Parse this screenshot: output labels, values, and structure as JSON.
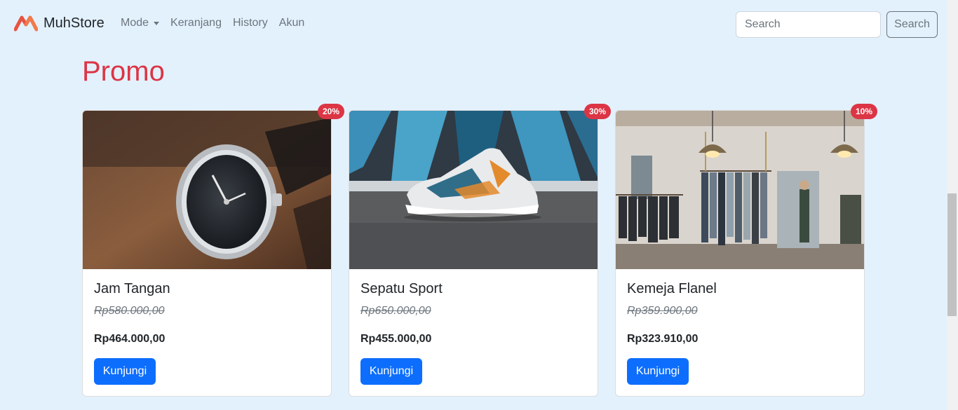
{
  "navbar": {
    "brand": "MuhStore",
    "items": [
      {
        "label": "Mode"
      },
      {
        "label": "Keranjang"
      },
      {
        "label": "History"
      },
      {
        "label": "Akun"
      }
    ],
    "search_placeholder": "Search",
    "search_button": "Search"
  },
  "promo": {
    "title": "Promo",
    "products": [
      {
        "name": "Jam Tangan",
        "discount": "20%",
        "old_price": "Rp580.000,00",
        "price": "Rp464.000,00",
        "button": "Kunjungi",
        "image_icon": "watch-icon"
      },
      {
        "name": "Sepatu Sport",
        "discount": "30%",
        "old_price": "Rp650.000,00",
        "price": "Rp455.000,00",
        "button": "Kunjungi",
        "image_icon": "shoe-icon"
      },
      {
        "name": "Kemeja Flanel",
        "discount": "10%",
        "old_price": "Rp359.900,00",
        "price": "Rp323.910,00",
        "button": "Kunjungi",
        "image_icon": "clothing-store-icon"
      }
    ]
  },
  "colors": {
    "background": "#e3f1fd",
    "primary": "#0d6efd",
    "danger": "#dc3545",
    "brand_logo": "#e8533f"
  }
}
